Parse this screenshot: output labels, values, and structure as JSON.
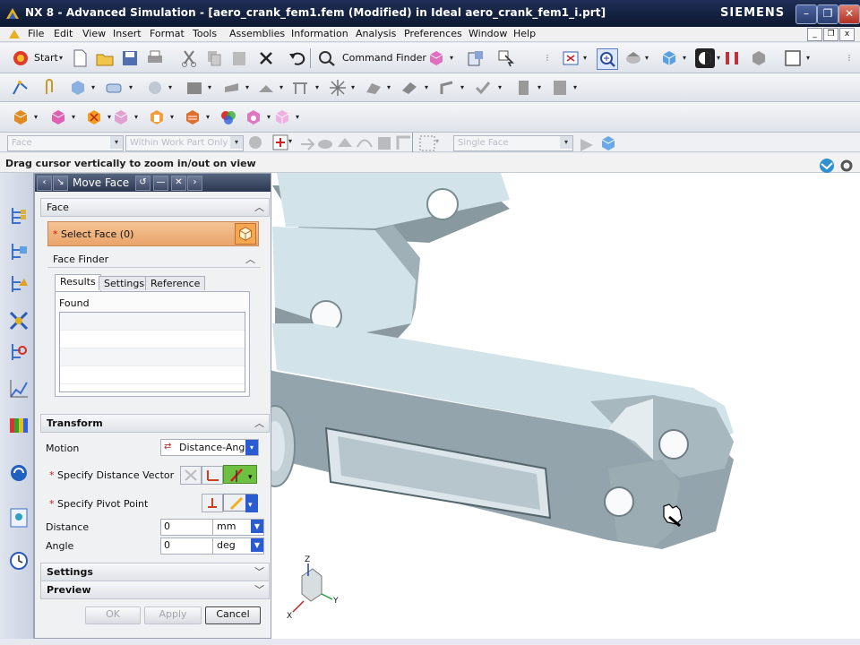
{
  "window": {
    "title": "NX 8 - Advanced Simulation - [aero_crank_fem1.fem (Modified)  in Ideal aero_crank_fem1_i.prt]",
    "brand": "SIEMENS"
  },
  "menu": [
    "File",
    "Edit",
    "View",
    "Insert",
    "Format",
    "Tools",
    "Assemblies",
    "Information",
    "Analysis",
    "Preferences",
    "Window",
    "Help"
  ],
  "toolbar": {
    "start_label": "Start",
    "command_finder_label": "Command Finder"
  },
  "selection_bar": {
    "filter": "Face",
    "scope": "Within Work Part Only",
    "mode": "Single Face"
  },
  "status": "Drag cursor vertically to zoom in/out on view",
  "dialog": {
    "title": "Move Face",
    "face_group": "Face",
    "select_face": "Select Face (0)",
    "face_finder_group": "Face Finder",
    "tabs": [
      "Results",
      "Settings",
      "Reference"
    ],
    "list_header": "Found",
    "transform_group": "Transform",
    "motion_label": "Motion",
    "motion_value": "Distance-Ang",
    "specify_distance_vector": "Specify Distance Vector",
    "specify_pivot_point": "Specify Pivot Point",
    "distance_label": "Distance",
    "distance_value": "0",
    "distance_unit": "mm",
    "angle_label": "Angle",
    "angle_value": "0",
    "angle_unit": "deg",
    "settings_group": "Settings",
    "preview_group": "Preview",
    "ok": "OK",
    "apply": "Apply",
    "cancel": "Cancel"
  },
  "colors": {
    "title_bar": "#13203e",
    "part_face": "#d2e3ea",
    "part_side": "#93a4ac",
    "select_highlight": "#f0b070"
  },
  "triad": {
    "z": "Z",
    "x": "X",
    "y": "Y"
  }
}
